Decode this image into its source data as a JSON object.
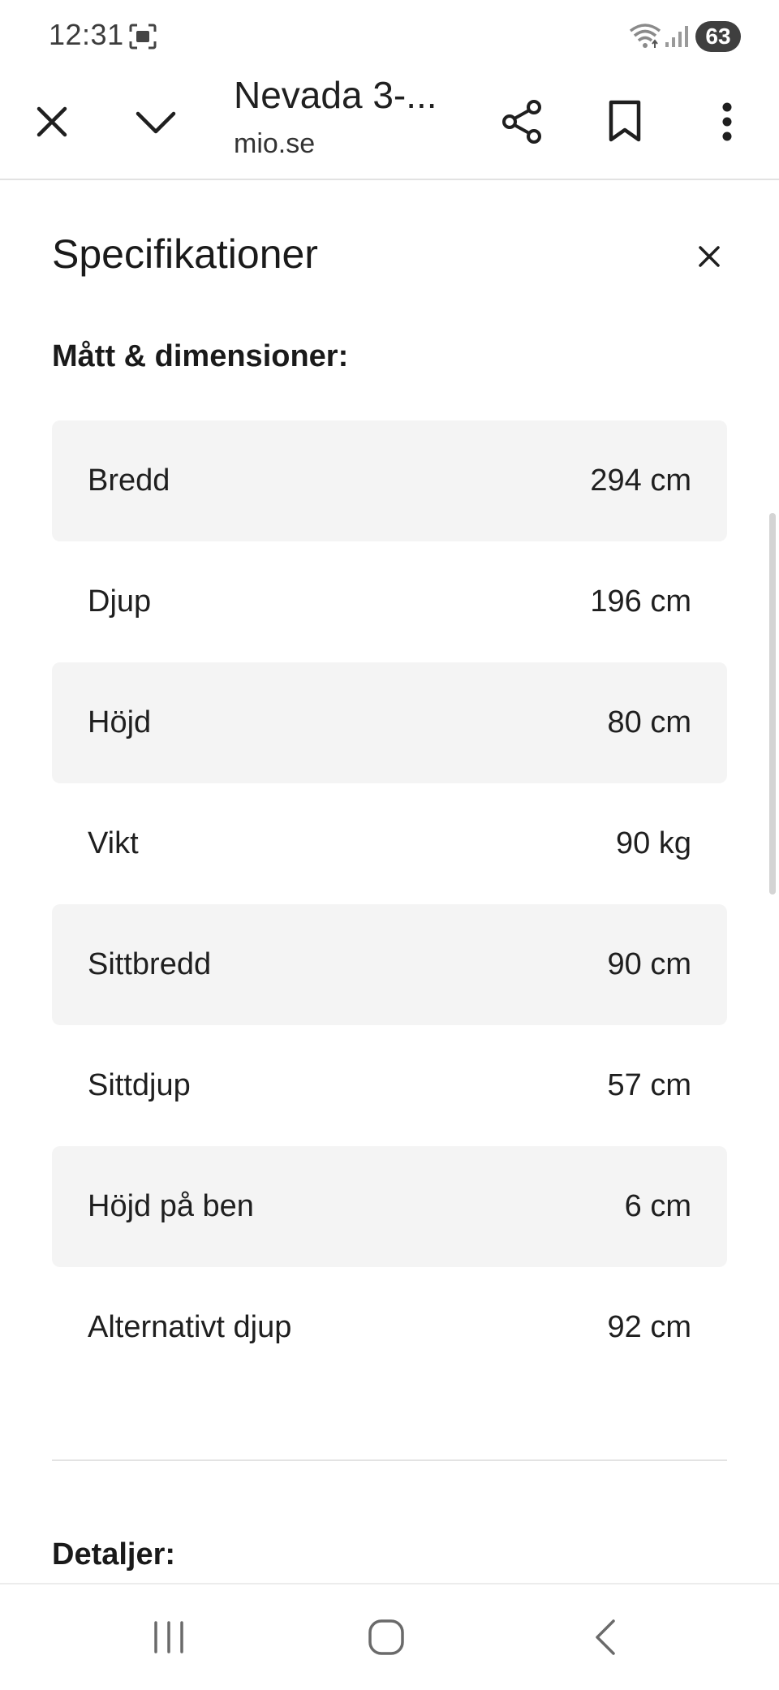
{
  "status_bar": {
    "time": "12:31",
    "battery": "63",
    "icons": [
      "screenshot-icon",
      "wifi-icon",
      "signal-icon"
    ]
  },
  "toolbar": {
    "title": "Nevada 3-...",
    "url": "mio.se",
    "icons": [
      "close-icon",
      "chevron-down-icon",
      "share-icon",
      "bookmark-icon",
      "more-vert-icon"
    ]
  },
  "panel": {
    "title": "Specifikationer",
    "dimensions_heading": "Mått & dimensioner:",
    "specs": [
      {
        "label": "Bredd",
        "value": "294 cm"
      },
      {
        "label": "Djup",
        "value": "196 cm"
      },
      {
        "label": "Höjd",
        "value": "80 cm"
      },
      {
        "label": "Vikt",
        "value": "90 kg"
      },
      {
        "label": "Sittbredd",
        "value": "90 cm"
      },
      {
        "label": "Sittdjup",
        "value": "57 cm"
      },
      {
        "label": "Höjd på ben",
        "value": "6 cm"
      },
      {
        "label": "Alternativt djup",
        "value": "92 cm"
      }
    ],
    "details_heading": "Detaljer:"
  },
  "nav_bar": {
    "icons": [
      "recents-icon",
      "home-icon",
      "back-icon"
    ]
  },
  "colors": {
    "row_shade": "#f4f4f4",
    "text": "#1a1a1a",
    "divider": "#e3e3e3"
  }
}
